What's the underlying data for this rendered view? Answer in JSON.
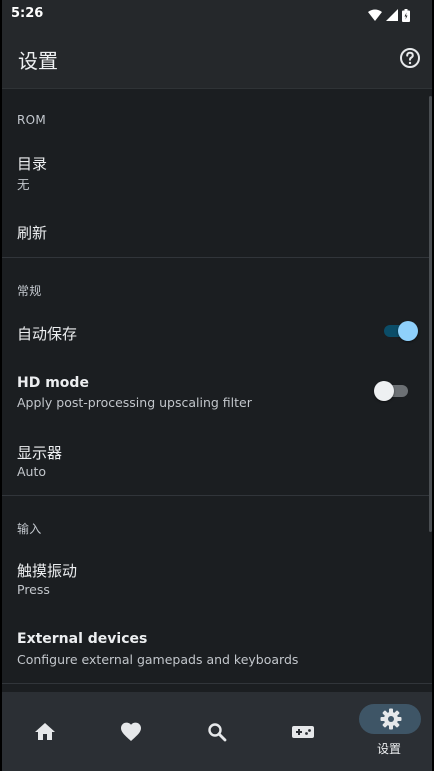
{
  "status": {
    "time": "5:26"
  },
  "appbar": {
    "title": "设置",
    "help_icon": "help-circle-icon"
  },
  "sections": {
    "rom": {
      "header": "ROM",
      "directory": {
        "title": "目录",
        "summary": "无"
      },
      "refresh": {
        "title": "刷新"
      }
    },
    "general": {
      "header": "常规",
      "autosave": {
        "title": "自动保存",
        "enabled": true
      },
      "hd_mode": {
        "title": "HD mode",
        "summary": "Apply post-processing upscaling filter",
        "enabled": false
      },
      "display": {
        "title": "显示器",
        "summary": "Auto"
      }
    },
    "input": {
      "header": "输入",
      "vibration": {
        "title": "触摸振动",
        "summary": "Press"
      },
      "external": {
        "title": "External devices",
        "summary": "Configure external gamepads and keyboards"
      }
    }
  },
  "bottom_nav": {
    "items": [
      {
        "icon": "home-icon",
        "label": ""
      },
      {
        "icon": "heart-icon",
        "label": ""
      },
      {
        "icon": "search-icon",
        "label": ""
      },
      {
        "icon": "gamepad-icon",
        "label": ""
      },
      {
        "icon": "settings-icon",
        "label": "设置",
        "selected": true
      }
    ]
  },
  "colors": {
    "background": "#1b1e21",
    "appbar": "#25282b",
    "switch_on_thumb": "#8fd0fb",
    "switch_on_track": "#0b4d68",
    "nav_selected_pill": "#3e5566"
  }
}
